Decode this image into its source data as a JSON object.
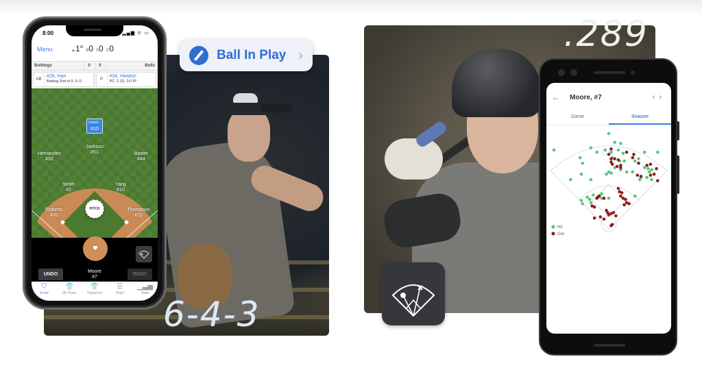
{
  "annotations": {
    "left_play": "6-4-3",
    "right_avg": ".289"
  },
  "ball_in_play": {
    "label": "Ball In Play",
    "chevron": "›",
    "icon": "bat-icon"
  },
  "iphone": {
    "status": {
      "time": "8:00",
      "icons": "▂▄▆ ᯤ ▭"
    },
    "header": {
      "menu": "Menu",
      "inning_arrow": "▲",
      "inning": "1",
      "inning_suffix": "st",
      "balls_label": "B",
      "balls": "0",
      "strikes_label": "S",
      "strikes": "0",
      "outs_label": "O",
      "outs": "0"
    },
    "scoreboard": {
      "away_team": "Bulldogs",
      "away_score": "0",
      "home_score": "0",
      "home_team": "Bulls"
    },
    "matchup": {
      "batter_tag": "AB",
      "batter_name": "#28, Han",
      "batter_sub": "Batting 2nd of 9, 0–0",
      "pitcher_tag": "P",
      "pitcher_name": "#34, Howton",
      "pitcher_sub": "PC: 2 (2), 0.0 IP"
    },
    "fielders": [
      {
        "name": "Jackson",
        "number": "#51"
      },
      {
        "name": "Hernandez",
        "number": "#32"
      },
      {
        "name": "Baxter",
        "number": "#44"
      },
      {
        "name": "Smith",
        "number": "#2"
      },
      {
        "name": "Yang",
        "number": "#10"
      },
      {
        "name": "Roberts",
        "number": "#20"
      },
      {
        "name": "Howton",
        "number": "#34"
      },
      {
        "name": "Thompson",
        "number": "#25"
      }
    ],
    "selected_position": {
      "label": "Lineel...",
      "number": "#10"
    },
    "pitch_button": "PITCH",
    "batter": {
      "name": "Moore",
      "number": "#7"
    },
    "undo": "UNDO",
    "redo": "REDO",
    "tabs": [
      {
        "label": "Score",
        "icon": "⛉",
        "active": true
      },
      {
        "label": "My Team",
        "icon": "👕",
        "active": false
      },
      {
        "label": "Opponent",
        "icon": "👕",
        "active": false
      },
      {
        "label": "Plays",
        "icon": "☰",
        "active": false
      },
      {
        "label": "Stats",
        "icon": "▁▃▅",
        "active": false
      }
    ]
  },
  "android": {
    "back": "←",
    "title": "Moore, #7",
    "prev": "‹",
    "next": "›",
    "tabs": [
      {
        "label": "Game",
        "active": false
      },
      {
        "label": "Season",
        "active": true
      }
    ],
    "legend": [
      {
        "label": "Hit",
        "color": "#5cc47f"
      },
      {
        "label": "Out",
        "color": "#8e1d1d"
      }
    ]
  },
  "chart_data": {
    "type": "scatter",
    "title": "Season spray chart — Moore, #7",
    "xlabel": "",
    "ylabel": "",
    "xlim": [
      0,
      100
    ],
    "ylim": [
      0,
      100
    ],
    "grid": false,
    "legend_position": "bottom-left",
    "series": [
      {
        "name": "Hit",
        "color": "#5cc47f",
        "points": [
          [
            50,
            95
          ],
          [
            55,
            87
          ],
          [
            60,
            86
          ],
          [
            4,
            80
          ],
          [
            35,
            82
          ],
          [
            40,
            78
          ],
          [
            47,
            80
          ],
          [
            52,
            78
          ],
          [
            58,
            80
          ],
          [
            62,
            77
          ],
          [
            80,
            78
          ],
          [
            26,
            73
          ],
          [
            28,
            68
          ],
          [
            53,
            73
          ],
          [
            59,
            70
          ],
          [
            72,
            70
          ],
          [
            75,
            72
          ],
          [
            91,
            78
          ],
          [
            63,
            70
          ],
          [
            55,
            64
          ],
          [
            60,
            62
          ],
          [
            65,
            60
          ],
          [
            83,
            63
          ],
          [
            80,
            64
          ],
          [
            84,
            60
          ],
          [
            86,
            62
          ],
          [
            50,
            60
          ],
          [
            52,
            59
          ],
          [
            27,
            58
          ],
          [
            48,
            58
          ],
          [
            70,
            60
          ],
          [
            88,
            58
          ],
          [
            82,
            55
          ],
          [
            18,
            53
          ],
          [
            35,
            53
          ],
          [
            86,
            53
          ],
          [
            76,
            53
          ],
          [
            77,
            55
          ],
          [
            44,
            40
          ],
          [
            37,
            39
          ],
          [
            32,
            37
          ],
          [
            44,
            36
          ],
          [
            50,
            36
          ],
          [
            72,
            38
          ],
          [
            27,
            34
          ],
          [
            34,
            35
          ],
          [
            35,
            32
          ],
          [
            28,
            31
          ]
        ]
      },
      {
        "name": "Out",
        "color": "#8e1d1d",
        "points": [
          [
            52,
            81
          ],
          [
            65,
            78
          ],
          [
            71,
            76
          ],
          [
            70,
            73
          ],
          [
            50,
            76
          ],
          [
            52,
            72
          ],
          [
            55,
            72
          ],
          [
            58,
            71
          ],
          [
            52,
            69
          ],
          [
            53,
            67
          ],
          [
            60,
            66
          ],
          [
            57,
            65
          ],
          [
            75,
            68
          ],
          [
            82,
            66
          ],
          [
            85,
            67
          ],
          [
            90,
            63
          ],
          [
            88,
            58
          ],
          [
            85,
            57
          ],
          [
            74,
            57
          ],
          [
            77,
            56
          ],
          [
            91,
            52
          ],
          [
            60,
            64
          ],
          [
            58,
            45
          ],
          [
            59,
            42
          ],
          [
            61,
            41
          ],
          [
            60,
            38
          ],
          [
            62,
            36
          ],
          [
            64,
            35
          ],
          [
            65,
            32
          ],
          [
            63,
            30
          ],
          [
            67,
            31
          ],
          [
            42,
            38
          ],
          [
            41,
            37
          ],
          [
            46,
            36
          ],
          [
            40,
            36
          ],
          [
            36,
            29
          ],
          [
            38,
            28
          ],
          [
            48,
            25
          ],
          [
            49,
            23
          ],
          [
            52,
            22
          ],
          [
            50,
            21
          ],
          [
            54,
            23
          ],
          [
            38,
            18
          ],
          [
            43,
            19
          ],
          [
            46,
            17
          ],
          [
            56,
            20
          ],
          [
            53,
            12
          ],
          [
            52,
            11
          ]
        ]
      }
    ]
  }
}
